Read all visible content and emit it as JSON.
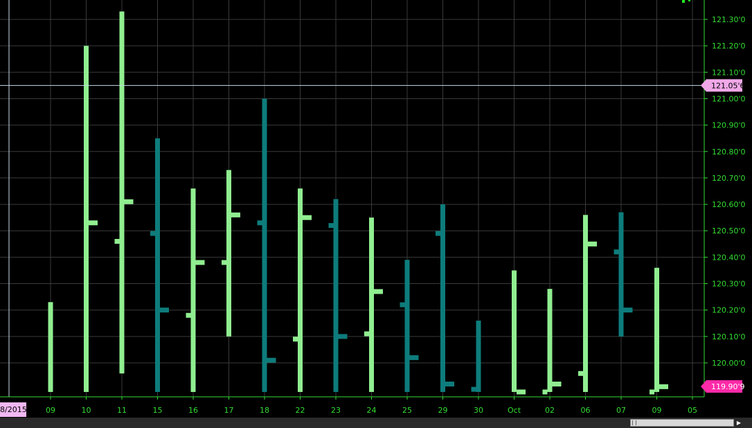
{
  "chart_data": {
    "type": "ohlc",
    "y_range": [
      119.89,
      121.35
    ],
    "y_ticks": [
      "121.30'0",
      "121.20'0",
      "121.10'0",
      "121.00'0",
      "120.90'0",
      "120.80'0",
      "120.70'0",
      "120.60'0",
      "120.50'0",
      "120.40'0",
      "120.30'0",
      "120.20'0",
      "120.10'0",
      "120.00'0"
    ],
    "y_tick_values": [
      121.3,
      121.2,
      121.1,
      121.0,
      120.9,
      120.8,
      120.7,
      120.6,
      120.5,
      120.4,
      120.3,
      120.2,
      120.1,
      120.0
    ],
    "x_labels": [
      "09",
      "10",
      "11",
      "15",
      "16",
      "17",
      "18",
      "22",
      "23",
      "24",
      "25",
      "29",
      "30",
      "Oct",
      "02",
      "06",
      "07",
      "09",
      "05"
    ],
    "colors": {
      "up": "#90ee90",
      "down": "#0e7c7c",
      "grid": "#3a3a3a",
      "axis": "#33dd33",
      "crosshair": "#c8d8e8",
      "tag_bg": "#f0a8e8",
      "tag_last_bg": "#ff2aa8"
    },
    "bars": [
      {
        "x": "09",
        "open": null,
        "high": 120.23,
        "low": 119.89,
        "close": null,
        "dir": "up"
      },
      {
        "x": "10",
        "open": null,
        "high": 121.2,
        "low": 119.89,
        "close": 120.53,
        "dir": "up"
      },
      {
        "x": "11",
        "open": 120.46,
        "high": 121.33,
        "low": 119.96,
        "close": 120.61,
        "dir": "up"
      },
      {
        "x": "15",
        "open": 120.49,
        "high": 120.85,
        "low": 119.89,
        "close": 120.2,
        "dir": "down"
      },
      {
        "x": "16",
        "open": 120.18,
        "high": 120.66,
        "low": 119.89,
        "close": 120.38,
        "dir": "up"
      },
      {
        "x": "17",
        "open": 120.38,
        "high": 120.73,
        "low": 120.1,
        "close": 120.56,
        "dir": "up"
      },
      {
        "x": "18",
        "open": 120.53,
        "high": 121.0,
        "low": 119.89,
        "close": 120.01,
        "dir": "down"
      },
      {
        "x": "22",
        "open": 120.09,
        "high": 120.66,
        "low": 119.89,
        "close": 120.55,
        "dir": "up"
      },
      {
        "x": "23",
        "open": 120.52,
        "high": 120.62,
        "low": 119.89,
        "close": 120.1,
        "dir": "down"
      },
      {
        "x": "24",
        "open": 120.11,
        "high": 120.55,
        "low": 119.89,
        "close": 120.27,
        "dir": "up"
      },
      {
        "x": "25",
        "open": 120.22,
        "high": 120.39,
        "low": 119.89,
        "close": 120.02,
        "dir": "down"
      },
      {
        "x": "29",
        "open": 120.49,
        "high": 120.6,
        "low": 119.89,
        "close": 119.92,
        "dir": "down"
      },
      {
        "x": "30",
        "open": 119.9,
        "high": 120.16,
        "low": 119.89,
        "close": null,
        "dir": "down"
      },
      {
        "x": "Oct",
        "open": null,
        "high": 120.35,
        "low": 119.89,
        "close": 119.89,
        "dir": "up"
      },
      {
        "x": "02",
        "open": 119.89,
        "high": 120.28,
        "low": 119.89,
        "close": 119.92,
        "dir": "up"
      },
      {
        "x": "06",
        "open": 119.96,
        "high": 120.56,
        "low": 119.89,
        "close": 120.45,
        "dir": "up"
      },
      {
        "x": "07",
        "open": 120.42,
        "high": 120.57,
        "low": 120.1,
        "close": 120.2,
        "dir": "down"
      },
      {
        "x": "09",
        "open": 119.89,
        "high": 120.36,
        "low": 119.89,
        "close": 119.91,
        "dir": "up"
      }
    ],
    "crosshair_value": 121.05,
    "crosshair_label": "121.05'6",
    "last_value": 119.91,
    "last_label": "119.90'9"
  },
  "start_date_label": "8/2015"
}
